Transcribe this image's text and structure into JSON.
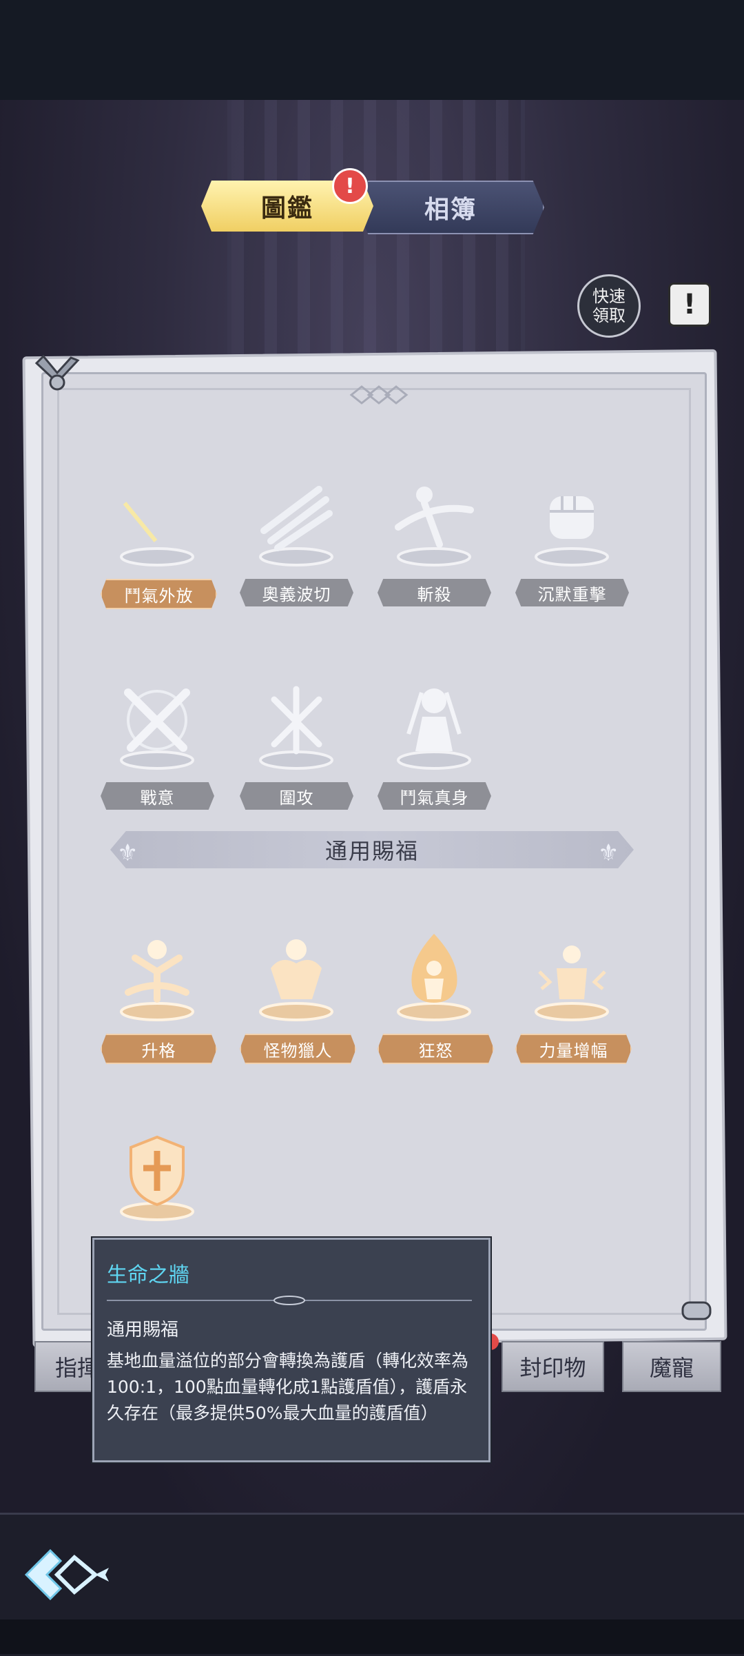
{
  "tabs": {
    "active_label": "圖鑑",
    "inactive_label": "相簿",
    "badge": "!"
  },
  "quick_claim": {
    "line1": "快速",
    "line2": "領取"
  },
  "info_button": "!",
  "skills_row1": [
    "鬥氣外放",
    "奧義波切",
    "斬殺",
    "沉默重擊"
  ],
  "skills_row2": [
    "戰意",
    "圍攻",
    "鬥氣真身"
  ],
  "section_title": "通用賜福",
  "blessings": [
    "升格",
    "怪物獵人",
    "狂怒",
    "力量增幅"
  ],
  "bottom_tabs": [
    "指揮",
    "封印物",
    "魔寵"
  ],
  "tooltip": {
    "title": "生命之牆",
    "category": "通用賜福",
    "description": "基地血量溢位的部分會轉換為護盾（轉化效率為100:1，100點血量轉化成1點護盾值），護盾永久存在（最多提供50%最大血量的護盾值）"
  },
  "colors": {
    "gold_plate": "#c7905e",
    "gray_plate": "#8e8f96",
    "tooltip_title": "#5fd6f2",
    "badge_red": "#e34a48"
  },
  "icons": [
    "crescent-slash-icon",
    "blade-wave-icon",
    "execute-icon",
    "fist-icon",
    "crossed-swords-icon",
    "siege-swords-icon",
    "warrior-avatar-icon",
    "ascend-icon",
    "monster-hunter-icon",
    "rage-flame-icon",
    "power-boost-icon",
    "shield-cross-icon",
    "game-logo-icon"
  ]
}
